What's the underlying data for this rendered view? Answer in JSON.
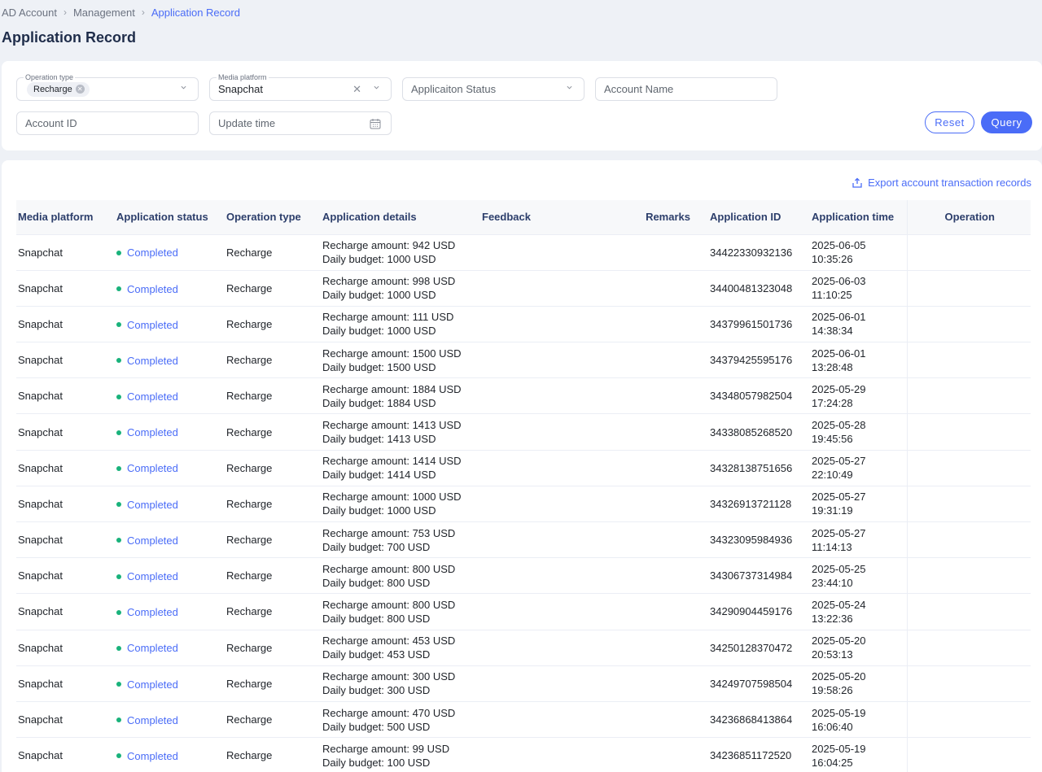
{
  "breadcrumb": {
    "items": [
      "AD Account",
      "Management",
      "Application Record"
    ]
  },
  "page_title": "Application Record",
  "filters": {
    "operation_type": {
      "label": "Operation type",
      "tag": "Recharge"
    },
    "media_platform": {
      "label": "Media platform",
      "value": "Snapchat"
    },
    "application_status": {
      "placeholder": "Applicaiton Status"
    },
    "account_name": {
      "placeholder": "Account Name"
    },
    "account_id": {
      "placeholder": "Account ID"
    },
    "update_time": {
      "placeholder": "Update time"
    },
    "reset_label": "Reset",
    "query_label": "Query"
  },
  "export_label": "Export account transaction records",
  "table": {
    "columns": [
      "Media platform",
      "Application status",
      "Operation type",
      "Application details",
      "Feedback",
      "Remarks",
      "Application ID",
      "Application time",
      "Operation"
    ],
    "rows": [
      {
        "platform": "Snapchat",
        "status": "Completed",
        "op_type": "Recharge",
        "amount": "Recharge amount: 942 USD",
        "budget": "Daily budget: 1000 USD",
        "id": "34422330932136",
        "time": "2025-06-05 10:35:26"
      },
      {
        "platform": "Snapchat",
        "status": "Completed",
        "op_type": "Recharge",
        "amount": "Recharge amount: 998 USD",
        "budget": "Daily budget: 1000 USD",
        "id": "34400481323048",
        "time": "2025-06-03 11:10:25"
      },
      {
        "platform": "Snapchat",
        "status": "Completed",
        "op_type": "Recharge",
        "amount": "Recharge amount: 111 USD",
        "budget": "Daily budget: 1000 USD",
        "id": "34379961501736",
        "time": "2025-06-01 14:38:34"
      },
      {
        "platform": "Snapchat",
        "status": "Completed",
        "op_type": "Recharge",
        "amount": "Recharge amount: 1500 USD",
        "budget": "Daily budget: 1500 USD",
        "id": "34379425595176",
        "time": "2025-06-01 13:28:48"
      },
      {
        "platform": "Snapchat",
        "status": "Completed",
        "op_type": "Recharge",
        "amount": "Recharge amount: 1884 USD",
        "budget": "Daily budget: 1884 USD",
        "id": "34348057982504",
        "time": "2025-05-29 17:24:28"
      },
      {
        "platform": "Snapchat",
        "status": "Completed",
        "op_type": "Recharge",
        "amount": "Recharge amount: 1413 USD",
        "budget": "Daily budget: 1413 USD",
        "id": "34338085268520",
        "time": "2025-05-28 19:45:56"
      },
      {
        "platform": "Snapchat",
        "status": "Completed",
        "op_type": "Recharge",
        "amount": "Recharge amount: 1414 USD",
        "budget": "Daily budget: 1414 USD",
        "id": "34328138751656",
        "time": "2025-05-27 22:10:49"
      },
      {
        "platform": "Snapchat",
        "status": "Completed",
        "op_type": "Recharge",
        "amount": "Recharge amount: 1000 USD",
        "budget": "Daily budget: 1000 USD",
        "id": "34326913721128",
        "time": "2025-05-27 19:31:19"
      },
      {
        "platform": "Snapchat",
        "status": "Completed",
        "op_type": "Recharge",
        "amount": "Recharge amount: 753 USD",
        "budget": "Daily budget: 700 USD",
        "id": "34323095984936",
        "time": "2025-05-27 11:14:13"
      },
      {
        "platform": "Snapchat",
        "status": "Completed",
        "op_type": "Recharge",
        "amount": "Recharge amount: 800 USD",
        "budget": "Daily budget: 800 USD",
        "id": "34306737314984",
        "time": "2025-05-25 23:44:10"
      },
      {
        "platform": "Snapchat",
        "status": "Completed",
        "op_type": "Recharge",
        "amount": "Recharge amount: 800 USD",
        "budget": "Daily budget: 800 USD",
        "id": "34290904459176",
        "time": "2025-05-24 13:22:36"
      },
      {
        "platform": "Snapchat",
        "status": "Completed",
        "op_type": "Recharge",
        "amount": "Recharge amount: 453 USD",
        "budget": "Daily budget: 453 USD",
        "id": "34250128370472",
        "time": "2025-05-20 20:53:13"
      },
      {
        "platform": "Snapchat",
        "status": "Completed",
        "op_type": "Recharge",
        "amount": "Recharge amount: 300 USD",
        "budget": "Daily budget: 300 USD",
        "id": "34249707598504",
        "time": "2025-05-20 19:58:26"
      },
      {
        "platform": "Snapchat",
        "status": "Completed",
        "op_type": "Recharge",
        "amount": "Recharge amount: 470 USD",
        "budget": "Daily budget: 500 USD",
        "id": "34236868413864",
        "time": "2025-05-19 16:06:40"
      },
      {
        "platform": "Snapchat",
        "status": "Completed",
        "op_type": "Recharge",
        "amount": "Recharge amount: 99 USD",
        "budget": "Daily budget: 100 USD",
        "id": "34236851172520",
        "time": "2025-05-19 16:04:25"
      }
    ]
  },
  "colors": {
    "accent": "#4a6cf7",
    "status_completed": "#19b27b"
  }
}
